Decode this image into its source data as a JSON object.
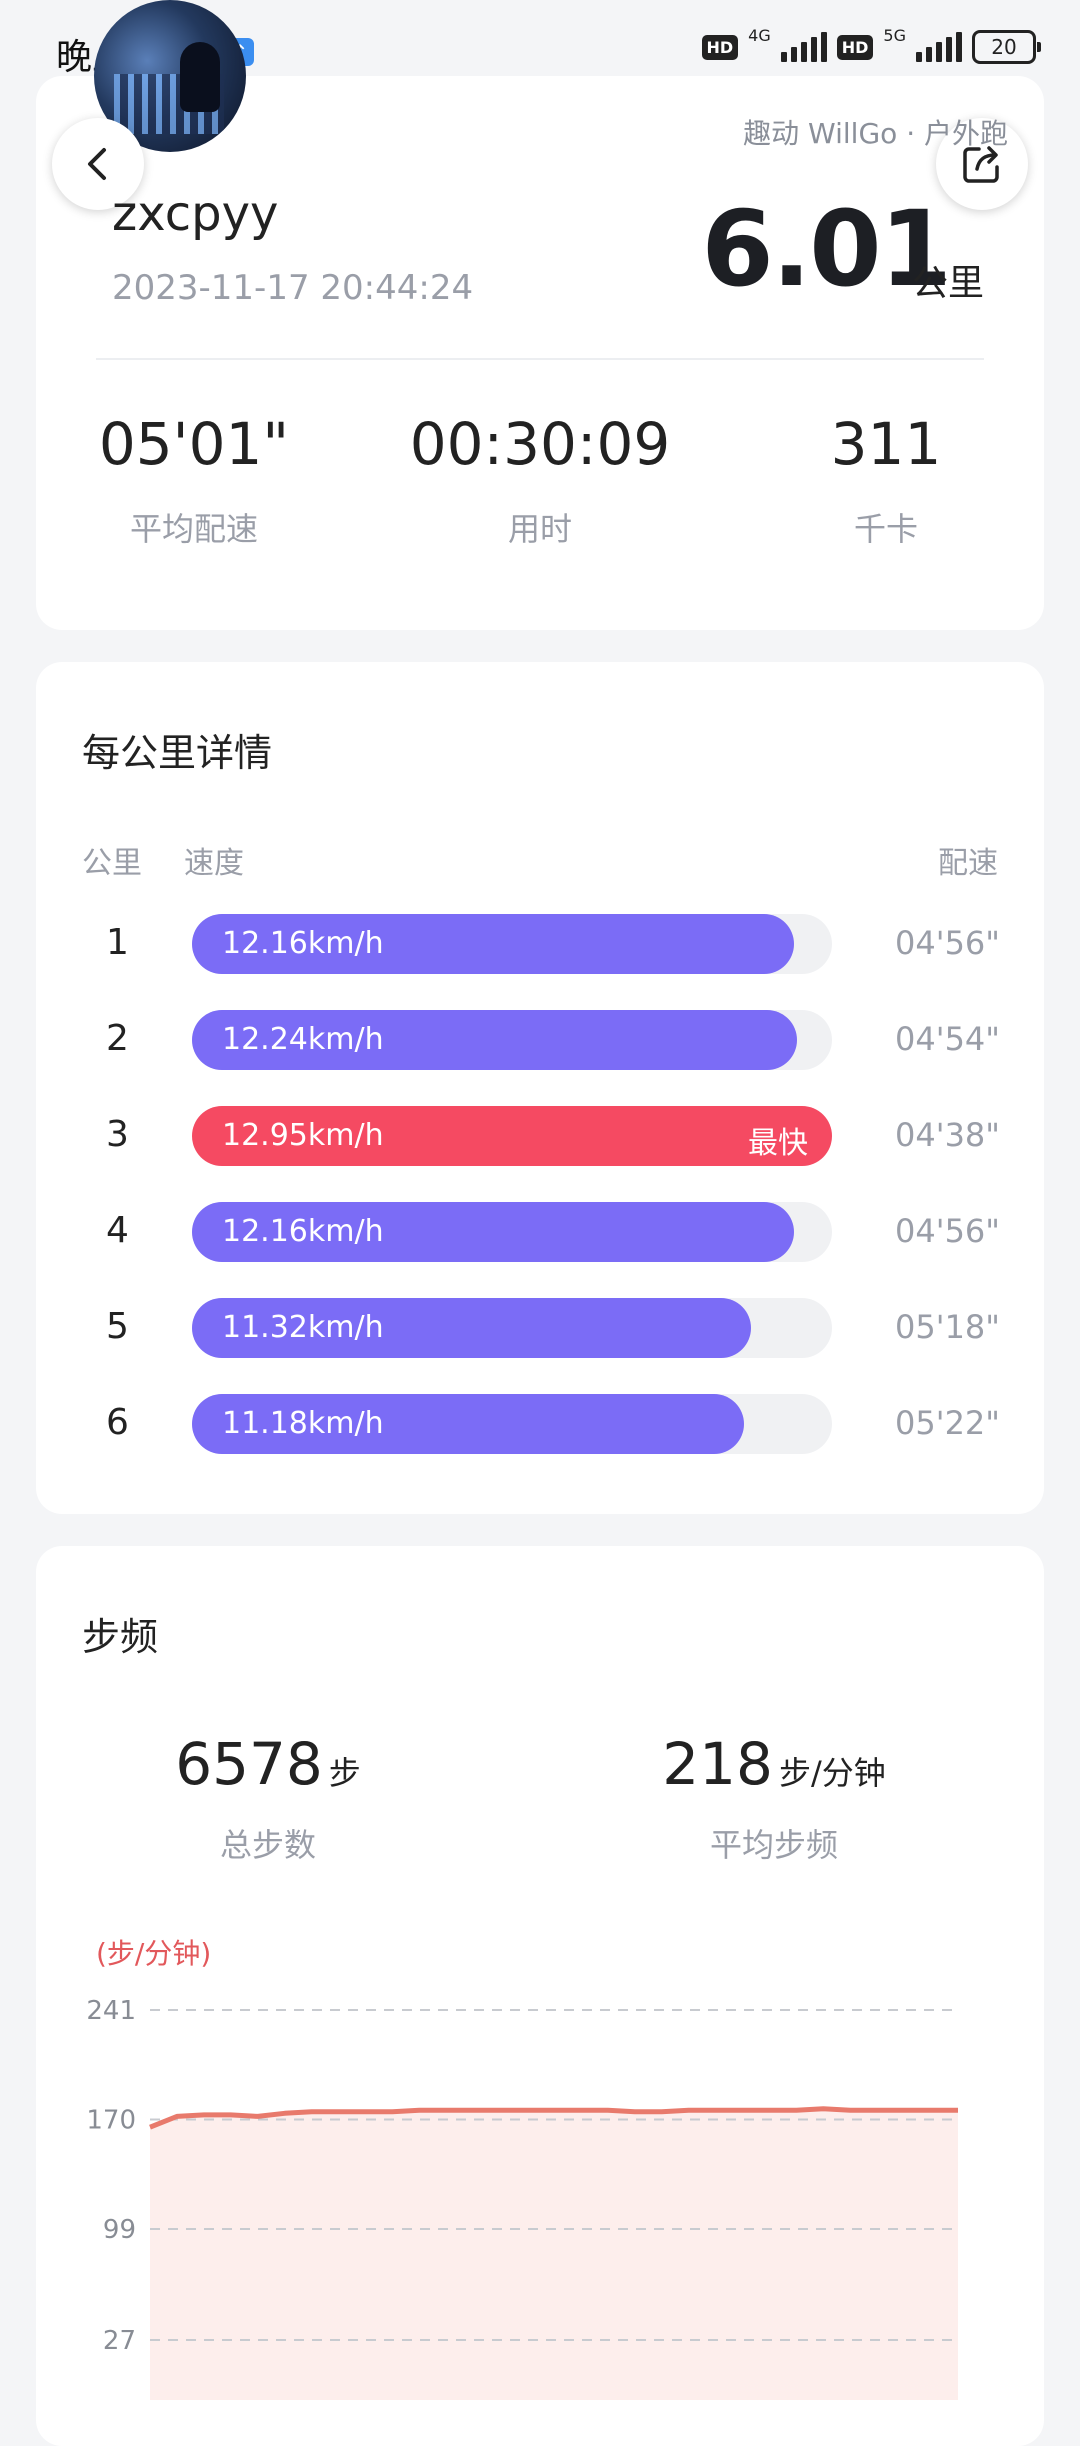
{
  "status_bar": {
    "time": "晚上10:17",
    "hd1": "HD",
    "net1": "4G",
    "hd2": "HD",
    "net2": "5G",
    "battery": "20"
  },
  "header": {
    "source": "趣动 WillGo · 户外跑",
    "username": "zxcpyy",
    "datetime": "2023-11-17 20:44:24",
    "distance": "6.01",
    "distance_unit": "公里"
  },
  "summary": {
    "stats": [
      {
        "value": "05'01\"",
        "label": "平均配速"
      },
      {
        "value": "00:30:09",
        "label": "用时"
      },
      {
        "value": "311",
        "label": "千卡"
      }
    ]
  },
  "per_km": {
    "title": "每公里详情",
    "col_km": "公里",
    "col_speed": "速度",
    "col_pace": "配速",
    "best_label": "最快",
    "rows": [
      {
        "km": "1",
        "speed": "12.16km/h",
        "pace": "04'56\"",
        "fraction": 0.94,
        "best": false
      },
      {
        "km": "2",
        "speed": "12.24km/h",
        "pace": "04'54\"",
        "fraction": 0.945,
        "best": false
      },
      {
        "km": "3",
        "speed": "12.95km/h",
        "pace": "04'38\"",
        "fraction": 1.0,
        "best": true
      },
      {
        "km": "4",
        "speed": "12.16km/h",
        "pace": "04'56\"",
        "fraction": 0.94,
        "best": false
      },
      {
        "km": "5",
        "speed": "11.32km/h",
        "pace": "05'18\"",
        "fraction": 0.874,
        "best": false
      },
      {
        "km": "6",
        "speed": "11.18km/h",
        "pace": "05'22\"",
        "fraction": 0.863,
        "best": false
      }
    ]
  },
  "cadence": {
    "title": "步频",
    "total_steps": "6578",
    "total_steps_unit": "步",
    "total_steps_label": "总步数",
    "avg_cadence": "218",
    "avg_cadence_unit": "步/分钟",
    "avg_cadence_label": "平均步频",
    "chart_unit": "(步/分钟)"
  },
  "colors": {
    "bar": "#7b6cf6",
    "best_bar": "#f54a62",
    "line": "#e87a6c",
    "area": "#fdeeec"
  },
  "chart_data": {
    "type": "area",
    "ylabel": "(步/分钟)",
    "yticks": [
      241,
      170,
      99,
      27
    ],
    "ylim": [
      27,
      241
    ],
    "grid": true,
    "x": [
      0,
      1,
      2,
      3,
      4,
      5,
      6,
      7,
      8,
      9,
      10,
      11,
      12,
      13,
      14,
      15,
      16,
      17,
      18,
      19,
      20,
      21,
      22,
      23,
      24,
      25,
      26,
      27,
      28,
      29,
      30
    ],
    "values": [
      165,
      172,
      173,
      173,
      172,
      174,
      175,
      175,
      175,
      175,
      176,
      176,
      176,
      176,
      176,
      176,
      176,
      176,
      175,
      175,
      176,
      176,
      176,
      176,
      176,
      177,
      176,
      176,
      176,
      176,
      176
    ]
  }
}
